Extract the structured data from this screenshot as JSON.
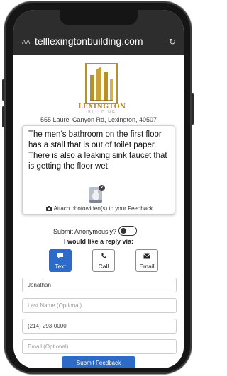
{
  "browser": {
    "text_size_label": "AA",
    "url": "telllexingtonbuilding.com",
    "reload_icon": "reload-icon"
  },
  "brand": {
    "name": "LEXINGTON",
    "subtitle": "BUILDING",
    "gold_color": "#b8902a"
  },
  "address": "555 Laurel Canyon Rd, Lexington, 40507",
  "feedback": {
    "message": "The men’s bathroom on the first floor has a stall that is out of toilet paper. There is also a leaking sink faucet that is getting the floor wet.",
    "attach_label": "Attach photo/video(s) to your Feedback",
    "attach_icon": "camera-icon"
  },
  "anonymous": {
    "label": "Submit Anonymously?",
    "enabled": false
  },
  "reply": {
    "label": "I would like a reply via:",
    "options": [
      {
        "label": "Text",
        "icon": "chat-icon",
        "selected": true
      },
      {
        "label": "Call",
        "icon": "phone-icon",
        "selected": false
      },
      {
        "label": "Email",
        "icon": "envelope-icon",
        "selected": false
      }
    ]
  },
  "form": {
    "first_name_value": "Jonathan",
    "last_name_placeholder": "Last Name (Optional)",
    "phone_value": "(214) 293-0000",
    "email_placeholder": "Email (Optional)",
    "submit_label": "Submit Feedback"
  },
  "colors": {
    "accent": "#2e6bc6",
    "browser_bar": "#2d2d2d"
  }
}
